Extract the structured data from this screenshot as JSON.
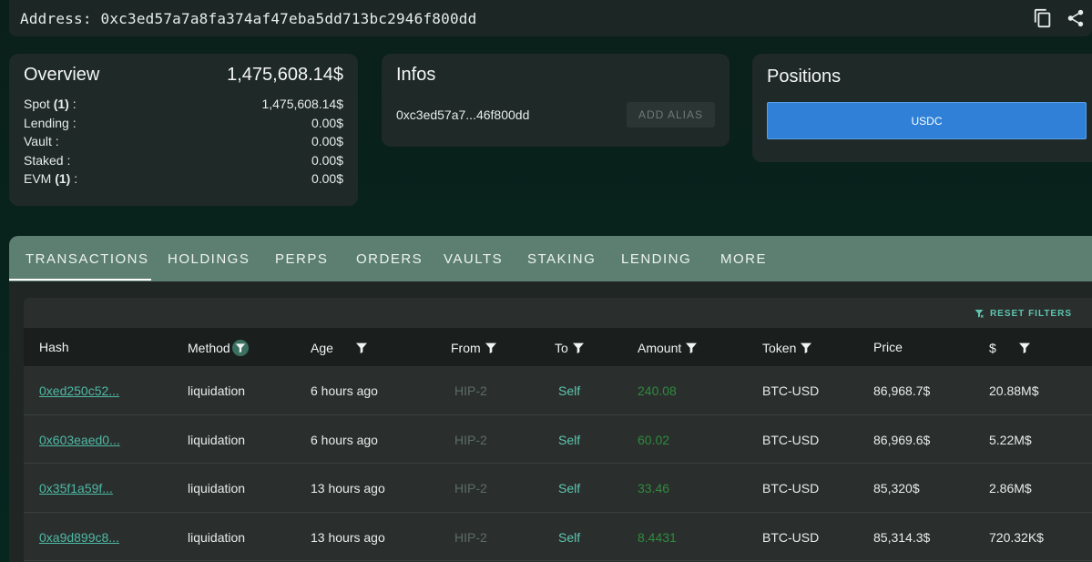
{
  "address_bar": {
    "label": "Address: 0xc3ed57a7a8fa374af47eba5dd713bc2946f800dd"
  },
  "overview": {
    "title": "Overview",
    "total": "1,475,608.14$",
    "rows": [
      {
        "label": "Spot ",
        "count": "(1)",
        "suffix": " :",
        "value": "1,475,608.14$"
      },
      {
        "label": "Lending :",
        "count": "",
        "suffix": "",
        "value": "0.00$"
      },
      {
        "label": "Vault :",
        "count": "",
        "suffix": "",
        "value": "0.00$"
      },
      {
        "label": "Staked :",
        "count": "",
        "suffix": "",
        "value": "0.00$"
      },
      {
        "label": "EVM ",
        "count": "(1)",
        "suffix": " :",
        "value": "0.00$"
      }
    ]
  },
  "infos": {
    "title": "Infos",
    "short_address": "0xc3ed57a7...46f800dd",
    "alias_button": "ADD ALIAS"
  },
  "positions": {
    "title": "Positions",
    "button": "USDC"
  },
  "tabs": [
    "TRANSACTIONS",
    "HOLDINGS",
    "PERPS",
    "ORDERS",
    "VAULTS",
    "STAKING",
    "LENDING",
    "MORE"
  ],
  "table": {
    "reset_filters": "RESET FILTERS",
    "columns": [
      "Hash",
      "Method",
      "Age",
      "From",
      "To",
      "Amount",
      "Token",
      "Price",
      "$"
    ],
    "rows": [
      {
        "hash": "0xed250c52...",
        "method": "liquidation",
        "age": "6 hours ago",
        "from": "HIP-2",
        "to": "Self",
        "amount": "240.08",
        "token": "BTC-USD",
        "price": "86,968.7$",
        "usd": "20.88M$"
      },
      {
        "hash": "0x603eaed0...",
        "method": "liquidation",
        "age": "6 hours ago",
        "from": "HIP-2",
        "to": "Self",
        "amount": "60.02",
        "token": "BTC-USD",
        "price": "86,969.6$",
        "usd": "5.22M$"
      },
      {
        "hash": "0x35f1a59f...",
        "method": "liquidation",
        "age": "13 hours ago",
        "from": "HIP-2",
        "to": "Self",
        "amount": "33.46",
        "token": "BTC-USD",
        "price": "85,320$",
        "usd": "2.86M$"
      },
      {
        "hash": "0xa9d899c8...",
        "method": "liquidation",
        "age": "13 hours ago",
        "from": "HIP-2",
        "to": "Self",
        "amount": "8.4431",
        "token": "BTC-USD",
        "price": "85,314.3$",
        "usd": "720.32K$"
      }
    ]
  },
  "icons": {
    "copy": "copy-icon",
    "share": "share-icon",
    "filter": "filter-icon"
  },
  "colors": {
    "accent": "#5ec5b0",
    "primary_button": "#2f80d6",
    "tabs_bar": "#5c7f72",
    "amount": "#2f8a3e"
  }
}
